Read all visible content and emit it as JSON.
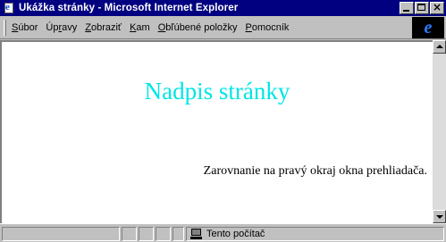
{
  "window": {
    "title": "Ukážka stránky - Microsoft Internet Explorer",
    "titlebar_color": "#000080"
  },
  "menu": {
    "items": [
      {
        "label_pre": "",
        "label_key": "S",
        "label_post": "úbor"
      },
      {
        "label_pre": "Úp",
        "label_key": "r",
        "label_post": "avy"
      },
      {
        "label_pre": "",
        "label_key": "Z",
        "label_post": "obraziť"
      },
      {
        "label_pre": "",
        "label_key": "K",
        "label_post": "am"
      },
      {
        "label_pre": "",
        "label_key": "O",
        "label_post": "bľúbené položky"
      },
      {
        "label_pre": "",
        "label_key": "P",
        "label_post": "omocník"
      }
    ],
    "logo_glyph": "e"
  },
  "page": {
    "heading": "Nadpis stránky",
    "heading_color": "#00e5e5",
    "paragraph": "Zarovnanie na pravý okraj okna prehliadača."
  },
  "status": {
    "zone_icon": "computer-icon",
    "zone_label": "Tento počítač"
  }
}
